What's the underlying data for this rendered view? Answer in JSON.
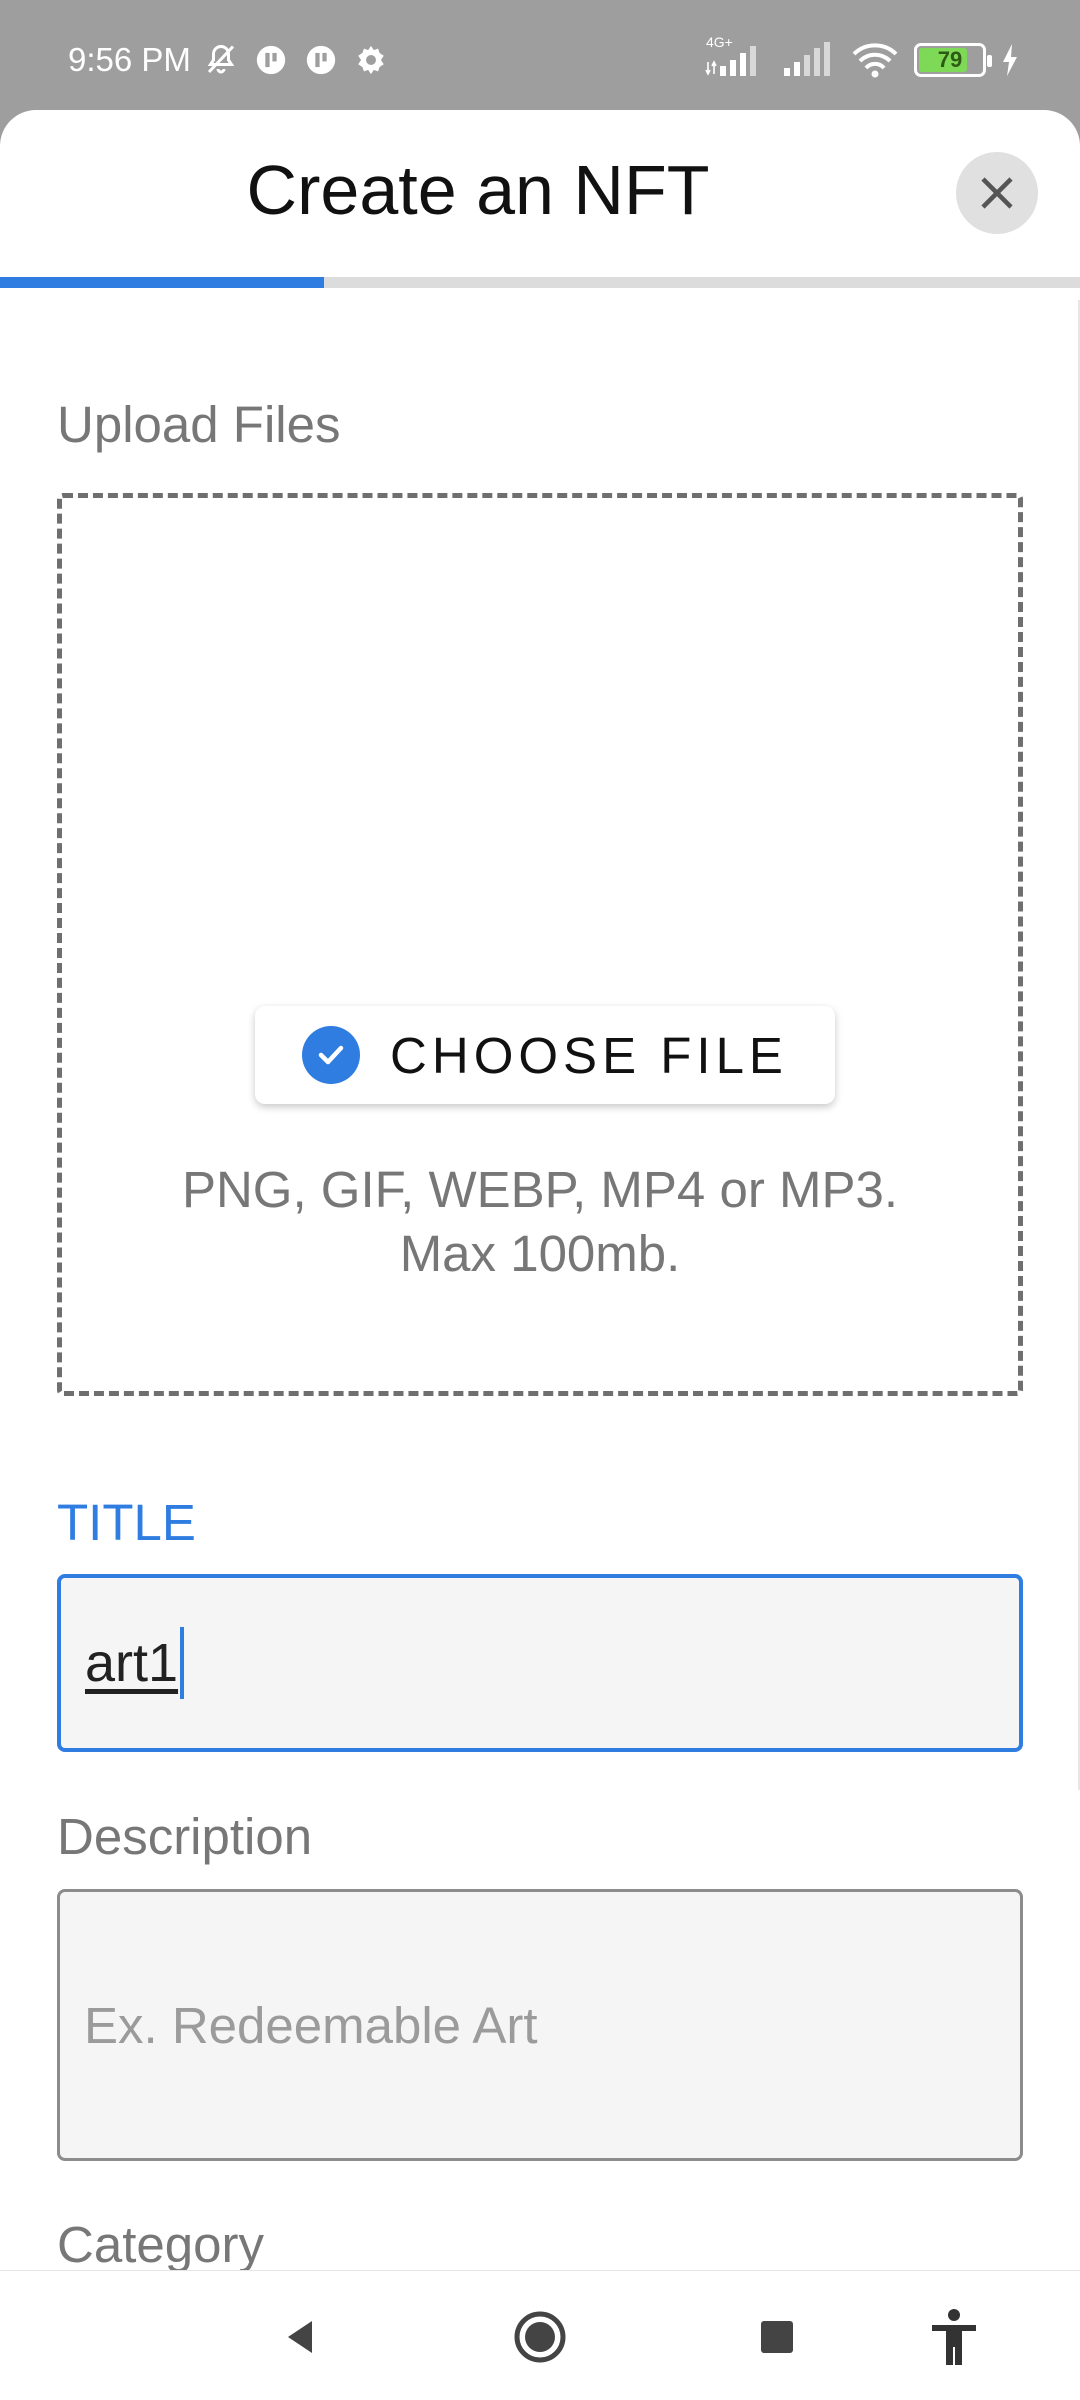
{
  "status_bar": {
    "time": "9:56 PM",
    "network_label": "4G+",
    "battery_level": "79",
    "battery_percent": 79,
    "icons": [
      "mute-icon",
      "app-notification-icon",
      "app-notification-icon",
      "settings-icon",
      "signal-icon",
      "signal-icon",
      "wifi-icon",
      "battery-icon",
      "charging-icon"
    ]
  },
  "sheet": {
    "title": "Create an NFT",
    "step_progress": 0.3
  },
  "upload": {
    "label": "Upload Files",
    "choose_button": "CHOOSE FILE",
    "hint_line1": "PNG, GIF, WEBP, MP4 or MP3.",
    "hint_line2": "Max 100mb."
  },
  "title_field": {
    "label": "TITLE",
    "value": "art1"
  },
  "description_field": {
    "label": "Description",
    "placeholder": "Ex. Redeemable Art"
  },
  "category_field": {
    "label": "Category"
  },
  "nav_bar": {
    "icons": [
      "back-icon",
      "home-icon",
      "recents-icon",
      "accessibility-icon"
    ]
  },
  "colors": {
    "accent": "#2f7de1",
    "status_bar_bg": "#9e9e9e",
    "battery_fill": "#7ed957"
  }
}
